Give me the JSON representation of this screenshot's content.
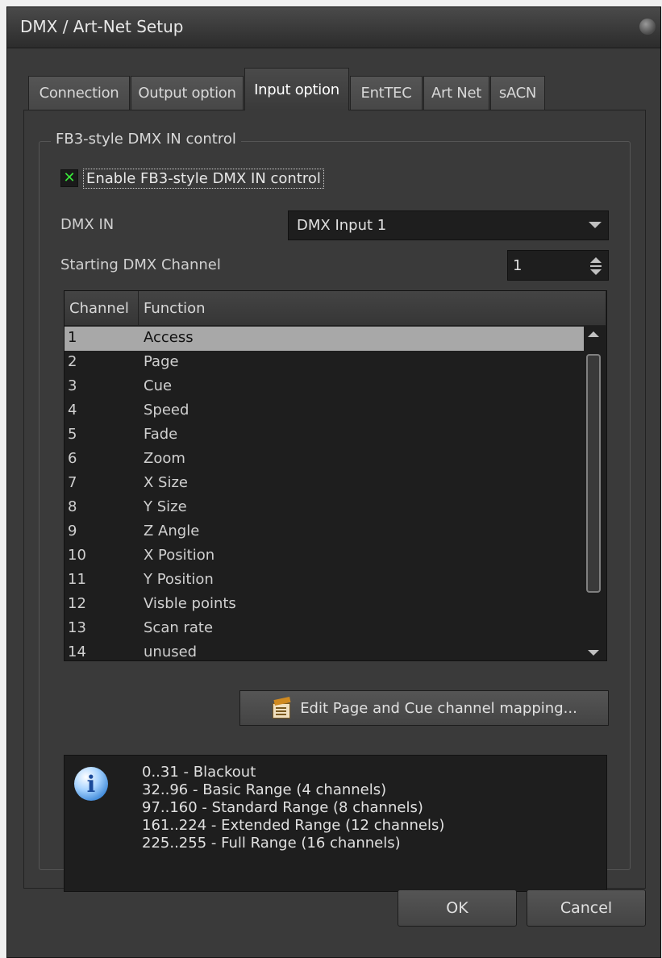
{
  "window": {
    "title": "DMX / Art-Net Setup"
  },
  "tabs": [
    {
      "label": "Connection"
    },
    {
      "label": "Output option"
    },
    {
      "label": "Input option",
      "active": true
    },
    {
      "label": "EntTEC"
    },
    {
      "label": "Art Net"
    },
    {
      "label": "sACN"
    }
  ],
  "group": {
    "title": "FB3-style DMX IN control",
    "enable_checkbox": {
      "label": "Enable FB3-style DMX IN control",
      "checked": true
    },
    "dmx_in": {
      "label": "DMX IN",
      "value": "DMX Input 1"
    },
    "starting_channel": {
      "label": "Starting DMX Channel",
      "value": "1"
    },
    "table": {
      "headers": [
        "Channel",
        "Function"
      ],
      "rows": [
        {
          "channel": "1",
          "function": "Access",
          "selected": true
        },
        {
          "channel": "2",
          "function": "Page"
        },
        {
          "channel": "3",
          "function": "Cue"
        },
        {
          "channel": "4",
          "function": "Speed"
        },
        {
          "channel": "5",
          "function": "Fade"
        },
        {
          "channel": "6",
          "function": "Zoom"
        },
        {
          "channel": "7",
          "function": "X Size"
        },
        {
          "channel": "8",
          "function": "Y Size"
        },
        {
          "channel": "9",
          "function": "Z Angle"
        },
        {
          "channel": "10",
          "function": "X Position"
        },
        {
          "channel": "11",
          "function": "Y Position"
        },
        {
          "channel": "12",
          "function": "Visble points"
        },
        {
          "channel": "13",
          "function": "Scan rate"
        },
        {
          "channel": "14",
          "function": "unused"
        }
      ]
    },
    "edit_mapping_button": "Edit Page and Cue channel mapping...",
    "info_lines": [
      "0..31 - Blackout",
      "32..96 - Basic Range (4 channels)",
      "97..160 - Standard Range (8 channels)",
      "161..224 - Extended Range (12 channels)",
      "225..255 - Full Range (16 channels)"
    ]
  },
  "footer": {
    "ok_label": "OK",
    "cancel_label": "Cancel"
  },
  "colors": {
    "background": "#3a3a3a",
    "field": "#1e1e1e",
    "selected_row": "#a8a8a8",
    "check": "#39e639"
  }
}
